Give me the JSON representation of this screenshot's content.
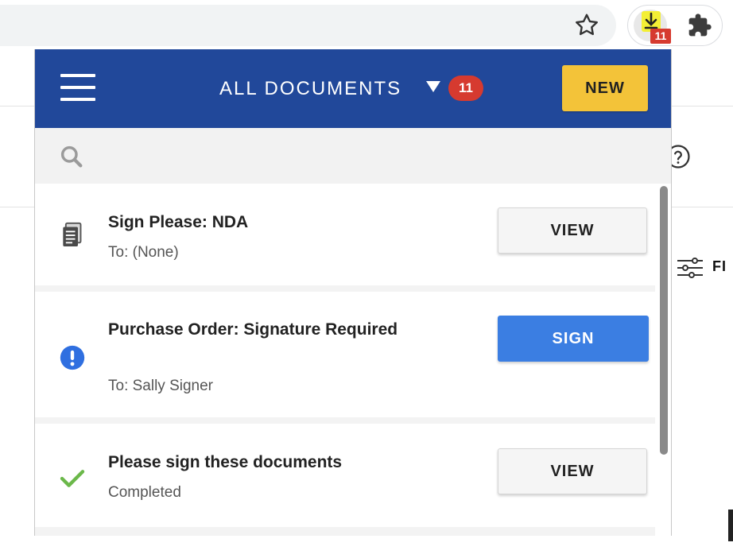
{
  "browser": {
    "extension_badge": "11",
    "background_filter_label": "FI"
  },
  "popup": {
    "header": {
      "title": "ALL DOCUMENTS",
      "badge_count": "11",
      "new_button_label": "NEW"
    },
    "search": {
      "placeholder": ""
    },
    "documents": [
      {
        "title": "Sign Please: NDA",
        "subtitle": "To: (None)",
        "status_icon": "document-icon",
        "action_label": "VIEW"
      },
      {
        "title": "Purchase Order: Signature Required",
        "subtitle": "To: Sally Signer",
        "status_icon": "alert-icon",
        "action_label": "SIGN"
      },
      {
        "title": "Please sign these documents",
        "subtitle": "Completed",
        "status_icon": "checkmark-icon",
        "action_label": "VIEW"
      }
    ]
  },
  "colors": {
    "header_bg": "#21489a",
    "new_button_bg": "#f3c339",
    "badge_red": "#d63a2f",
    "sign_button_bg": "#3b7ee2",
    "alert_blue": "#2f6fe0",
    "check_green": "#6bb84a"
  }
}
